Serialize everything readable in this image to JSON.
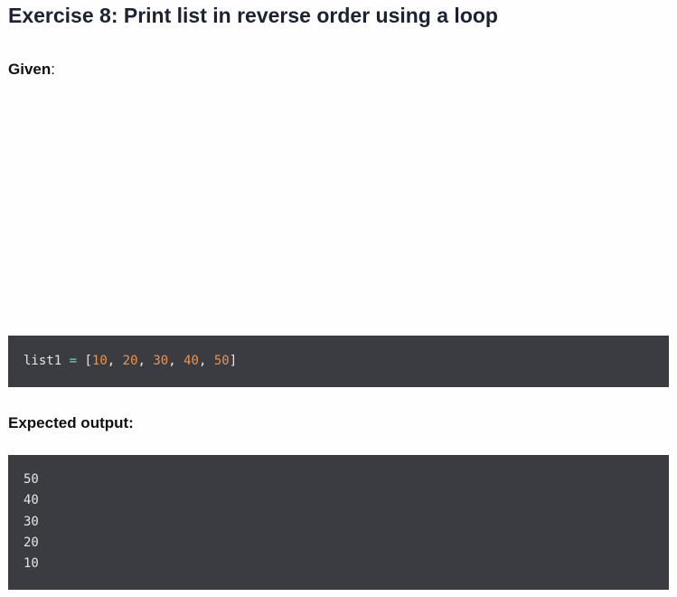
{
  "title": "Exercise 8: Print list in reverse order using a loop",
  "given": {
    "label": "Given",
    "suffix": ":"
  },
  "given_code": {
    "variable": "list1",
    "operator": "=",
    "open_bracket": "[",
    "close_bracket": "]",
    "separator": ",",
    "values": [
      "10",
      "20",
      "30",
      "40",
      "50"
    ]
  },
  "expected": {
    "label": "Expected output:"
  },
  "output_lines": [
    "50",
    "40",
    "30",
    "20",
    "10"
  ],
  "colors": {
    "code_background": "#3a3c41",
    "number": "#f0924c",
    "operator": "#66d9c4",
    "code_text": "#e6e6e6"
  }
}
